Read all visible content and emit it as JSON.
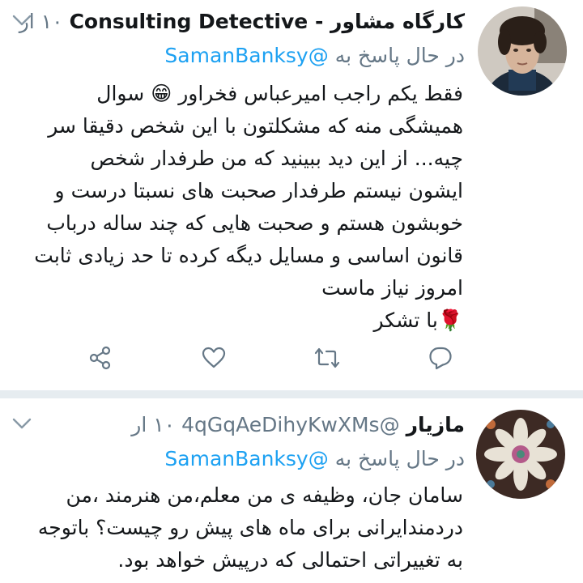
{
  "tweets": [
    {
      "display_name": "کارگاه مشاور - Consulting Detective",
      "handle": "",
      "time": "۱۰ ار",
      "replying_prefix": "در حال پاسخ به",
      "replying_to": "@SamanBanksy",
      "avatar": "avatar-man-dark-curly-hair",
      "lines": [
        "فقط یکم راجب امیرعباس فخراور 😁 سوال",
        "همیشگی منه که مشکلتون با این شخص دقیقا سر",
        "چیه... از این دید ببینید که من طرفدار شخص",
        "ایشون نیستم طرفدار صحبت های نسبتا درست و",
        "خوبشون هستم و صحبت هایی که چند ساله درباب",
        "قانون اساسی و مسایل دیگه کرده تا حد زیادی ثابت",
        "امروز نیاز ماست",
        "🌹با تشکر"
      ],
      "actions": [
        "share-icon",
        "like-icon",
        "retweet-icon",
        "reply-icon"
      ]
    },
    {
      "display_name": "مازیار",
      "handle": "@4qGqAeDihyKwXMs",
      "time": "۱۰ ار",
      "replying_prefix": "در حال پاسخ به",
      "replying_to": "@SamanBanksy",
      "avatar": "avatar-embroidered-flower",
      "lines": [
        "سامان جان، وظیفه ی من معلم،من هنرمند ،من",
        "دردمندایرانی برای ماه های پیش رو چیست؟ باتوجه",
        "به تغییراتی احتمالی که درپیش خواهد بود."
      ]
    }
  ],
  "colors": {
    "text": "#14171a",
    "secondary": "#657786",
    "accent": "#1da1f2",
    "divider": "#e6ecf0"
  }
}
